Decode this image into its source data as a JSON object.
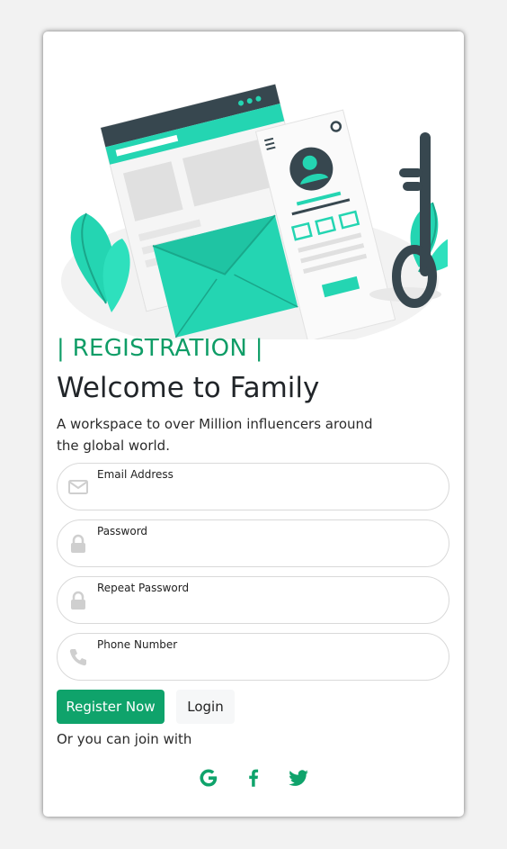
{
  "header": {
    "eyebrow": "| REGISTRATION |",
    "title": "Welcome to Family",
    "subtitle": "A workspace to over Million influencers around the global world."
  },
  "form": {
    "email": {
      "label": "Email Address",
      "value": ""
    },
    "password": {
      "label": "Password",
      "value": ""
    },
    "repeat_password": {
      "label": "Repeat Password",
      "value": ""
    },
    "phone": {
      "label": "Phone Number",
      "value": ""
    }
  },
  "actions": {
    "register_label": "Register Now",
    "login_label": "Login"
  },
  "social": {
    "prompt": "Or you can join with",
    "providers": [
      "google-icon",
      "facebook-icon",
      "twitter-icon"
    ]
  },
  "colors": {
    "accent": "#0fa36b",
    "illustration_teal": "#24d5b2",
    "dark": "#37474f",
    "background": "#f2f2f2"
  }
}
